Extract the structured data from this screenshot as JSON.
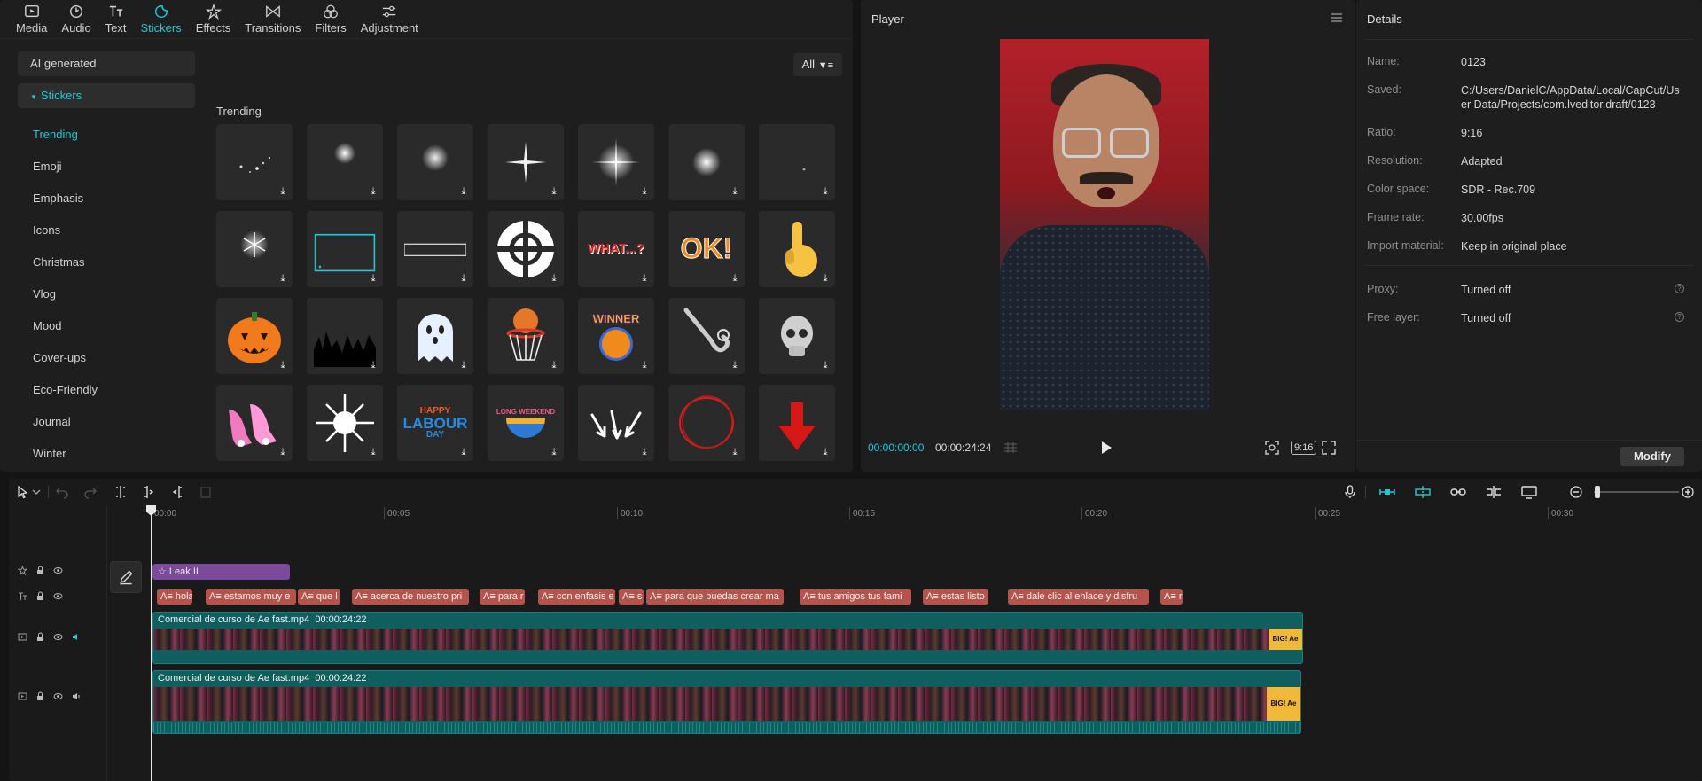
{
  "toolbar": {
    "tabs": [
      {
        "label": "Media",
        "icon": "media-icon"
      },
      {
        "label": "Audio",
        "icon": "audio-icon"
      },
      {
        "label": "Text",
        "icon": "text-icon"
      },
      {
        "label": "Stickers",
        "icon": "stickers-icon"
      },
      {
        "label": "Effects",
        "icon": "effects-icon"
      },
      {
        "label": "Transitions",
        "icon": "transitions-icon"
      },
      {
        "label": "Filters",
        "icon": "filters-icon"
      },
      {
        "label": "Adjustment",
        "icon": "adjustment-icon"
      }
    ],
    "active_tab": "Stickers"
  },
  "sidebar": {
    "ai_generated": "AI generated",
    "stickers_header": "Stickers",
    "items": [
      "Trending",
      "Emoji",
      "Emphasis",
      "Icons",
      "Christmas",
      "Vlog",
      "Mood",
      "Cover-ups",
      "Eco-Friendly",
      "Journal",
      "Winter"
    ],
    "active_item": "Trending"
  },
  "stickers": {
    "filter_label": "All",
    "section_label": "Trending",
    "row3_texts": [
      "WHAT...?",
      "OK!"
    ],
    "winner_text": "WINNER",
    "labour_text": [
      "HAPPY",
      "LABOUR",
      "DAY"
    ],
    "weekend_text": "LONG WEEKEND"
  },
  "player": {
    "title": "Player",
    "current_time": "00:00:00:00",
    "total_time": "00:00:24:24",
    "ratio": "9:16"
  },
  "details": {
    "title": "Details",
    "rows": [
      {
        "label": "Name:",
        "value": "0123"
      },
      {
        "label": "Saved:",
        "value": "C:/Users/DanielC/AppData/Local/CapCut/User Data/Projects/com.lveditor.draft/0123"
      },
      {
        "label": "Ratio:",
        "value": "9:16"
      },
      {
        "label": "Resolution:",
        "value": "Adapted"
      },
      {
        "label": "Color space:",
        "value": "SDR - Rec.709"
      },
      {
        "label": "Frame rate:",
        "value": "30.00fps"
      },
      {
        "label": "Import material:",
        "value": "Keep in original place"
      }
    ],
    "rows2": [
      {
        "label": "Proxy:",
        "value": "Turned off"
      },
      {
        "label": "Free layer:",
        "value": "Turned off"
      }
    ],
    "modify_label": "Modify"
  },
  "timeline": {
    "ticks": [
      "00:00",
      "00:05",
      "00:10",
      "00:15",
      "00:20",
      "00:25",
      "00:30"
    ],
    "effect_clip": "Leak II",
    "text_clips": [
      {
        "label": "hola"
      },
      {
        "label": "estamos muy e"
      },
      {
        "label": "que l"
      },
      {
        "label": "acerca de nuestro pri"
      },
      {
        "label": "para r"
      },
      {
        "label": "con enfasis e"
      },
      {
        "label": "s"
      },
      {
        "label": "para que puedas crear ma"
      },
      {
        "label": "tus amigos tus fami"
      },
      {
        "label": "estas listo"
      },
      {
        "label": "dale clic al enlace y disfru"
      },
      {
        "label": "r"
      }
    ],
    "text_prefix": "A≡",
    "video_clip_1": {
      "name": "Comercial de curso de Ae fast.mp4",
      "duration": "00:00:24:22"
    },
    "video_clip_2": {
      "name": "Comercial de curso de Ae fast.mp4",
      "duration": "00:00:24:22"
    },
    "endcap_text": "BIG! Ae"
  }
}
